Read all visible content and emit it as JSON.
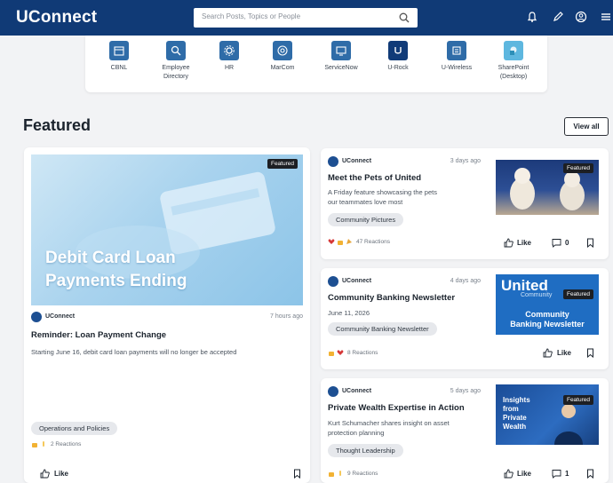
{
  "header": {
    "brand": "UConnect",
    "search_placeholder": "Search Posts, Topics or People"
  },
  "apps": [
    {
      "label": "CBNL",
      "icon": "building-icon"
    },
    {
      "label": "Employee Directory",
      "icon": "search-person-icon"
    },
    {
      "label": "HR",
      "icon": "gear-icon"
    },
    {
      "label": "MarCom",
      "icon": "target-icon"
    },
    {
      "label": "ServiceNow",
      "icon": "monitor-icon"
    },
    {
      "label": "U-Rock",
      "icon": "u-rock-icon"
    },
    {
      "label": "U-Wireless",
      "icon": "wireless-icon"
    },
    {
      "label": "SharePoint (Desktop)",
      "icon": "sharepoint-icon"
    }
  ],
  "featured": {
    "title": "Featured",
    "view_all": "View all"
  },
  "posts": [
    {
      "source": "UConnect",
      "time": "7 hours ago",
      "title": "Reminder: Loan Payment Change",
      "description": "Starting June 16, debit card loan payments will no longer be accepted",
      "tag": "Operations and Policies",
      "reactions": "2 Reactions",
      "badge": "Featured",
      "image_text_1": "Debit Card Loan",
      "image_text_2": "Payments Ending",
      "like": "Like"
    },
    {
      "source": "UConnect",
      "time": "3 days ago",
      "title": "Meet the Pets of United",
      "description": "A Friday feature showcasing the pets our teammates love most",
      "tag": "Community Pictures",
      "reactions": "47 Reactions",
      "badge": "Featured",
      "like": "Like",
      "comments": "0"
    },
    {
      "source": "UConnect",
      "time": "4 days ago",
      "title": "Community Banking Newsletter",
      "description": "June 11, 2026",
      "tag": "Community Banking Newsletter",
      "reactions": "8 Reactions",
      "badge": "Featured",
      "image_logo": "United",
      "image_logo_sub": "Community",
      "image_text_1": "Community",
      "image_text_2": "Banking Newsletter",
      "like": "Like"
    },
    {
      "source": "UConnect",
      "time": "5 days ago",
      "title": "Private Wealth Expertise in Action",
      "description": "Kurt Schumacher shares insight on asset protection planning",
      "tag": "Thought Leadership",
      "reactions": "9 Reactions",
      "badge": "Featured",
      "image_text": [
        "Insights",
        "from",
        "Private",
        "Wealth"
      ],
      "like": "Like",
      "comments": "1"
    }
  ],
  "colors": {
    "header_bg": "#103a76",
    "accent": "#1d4f92"
  }
}
